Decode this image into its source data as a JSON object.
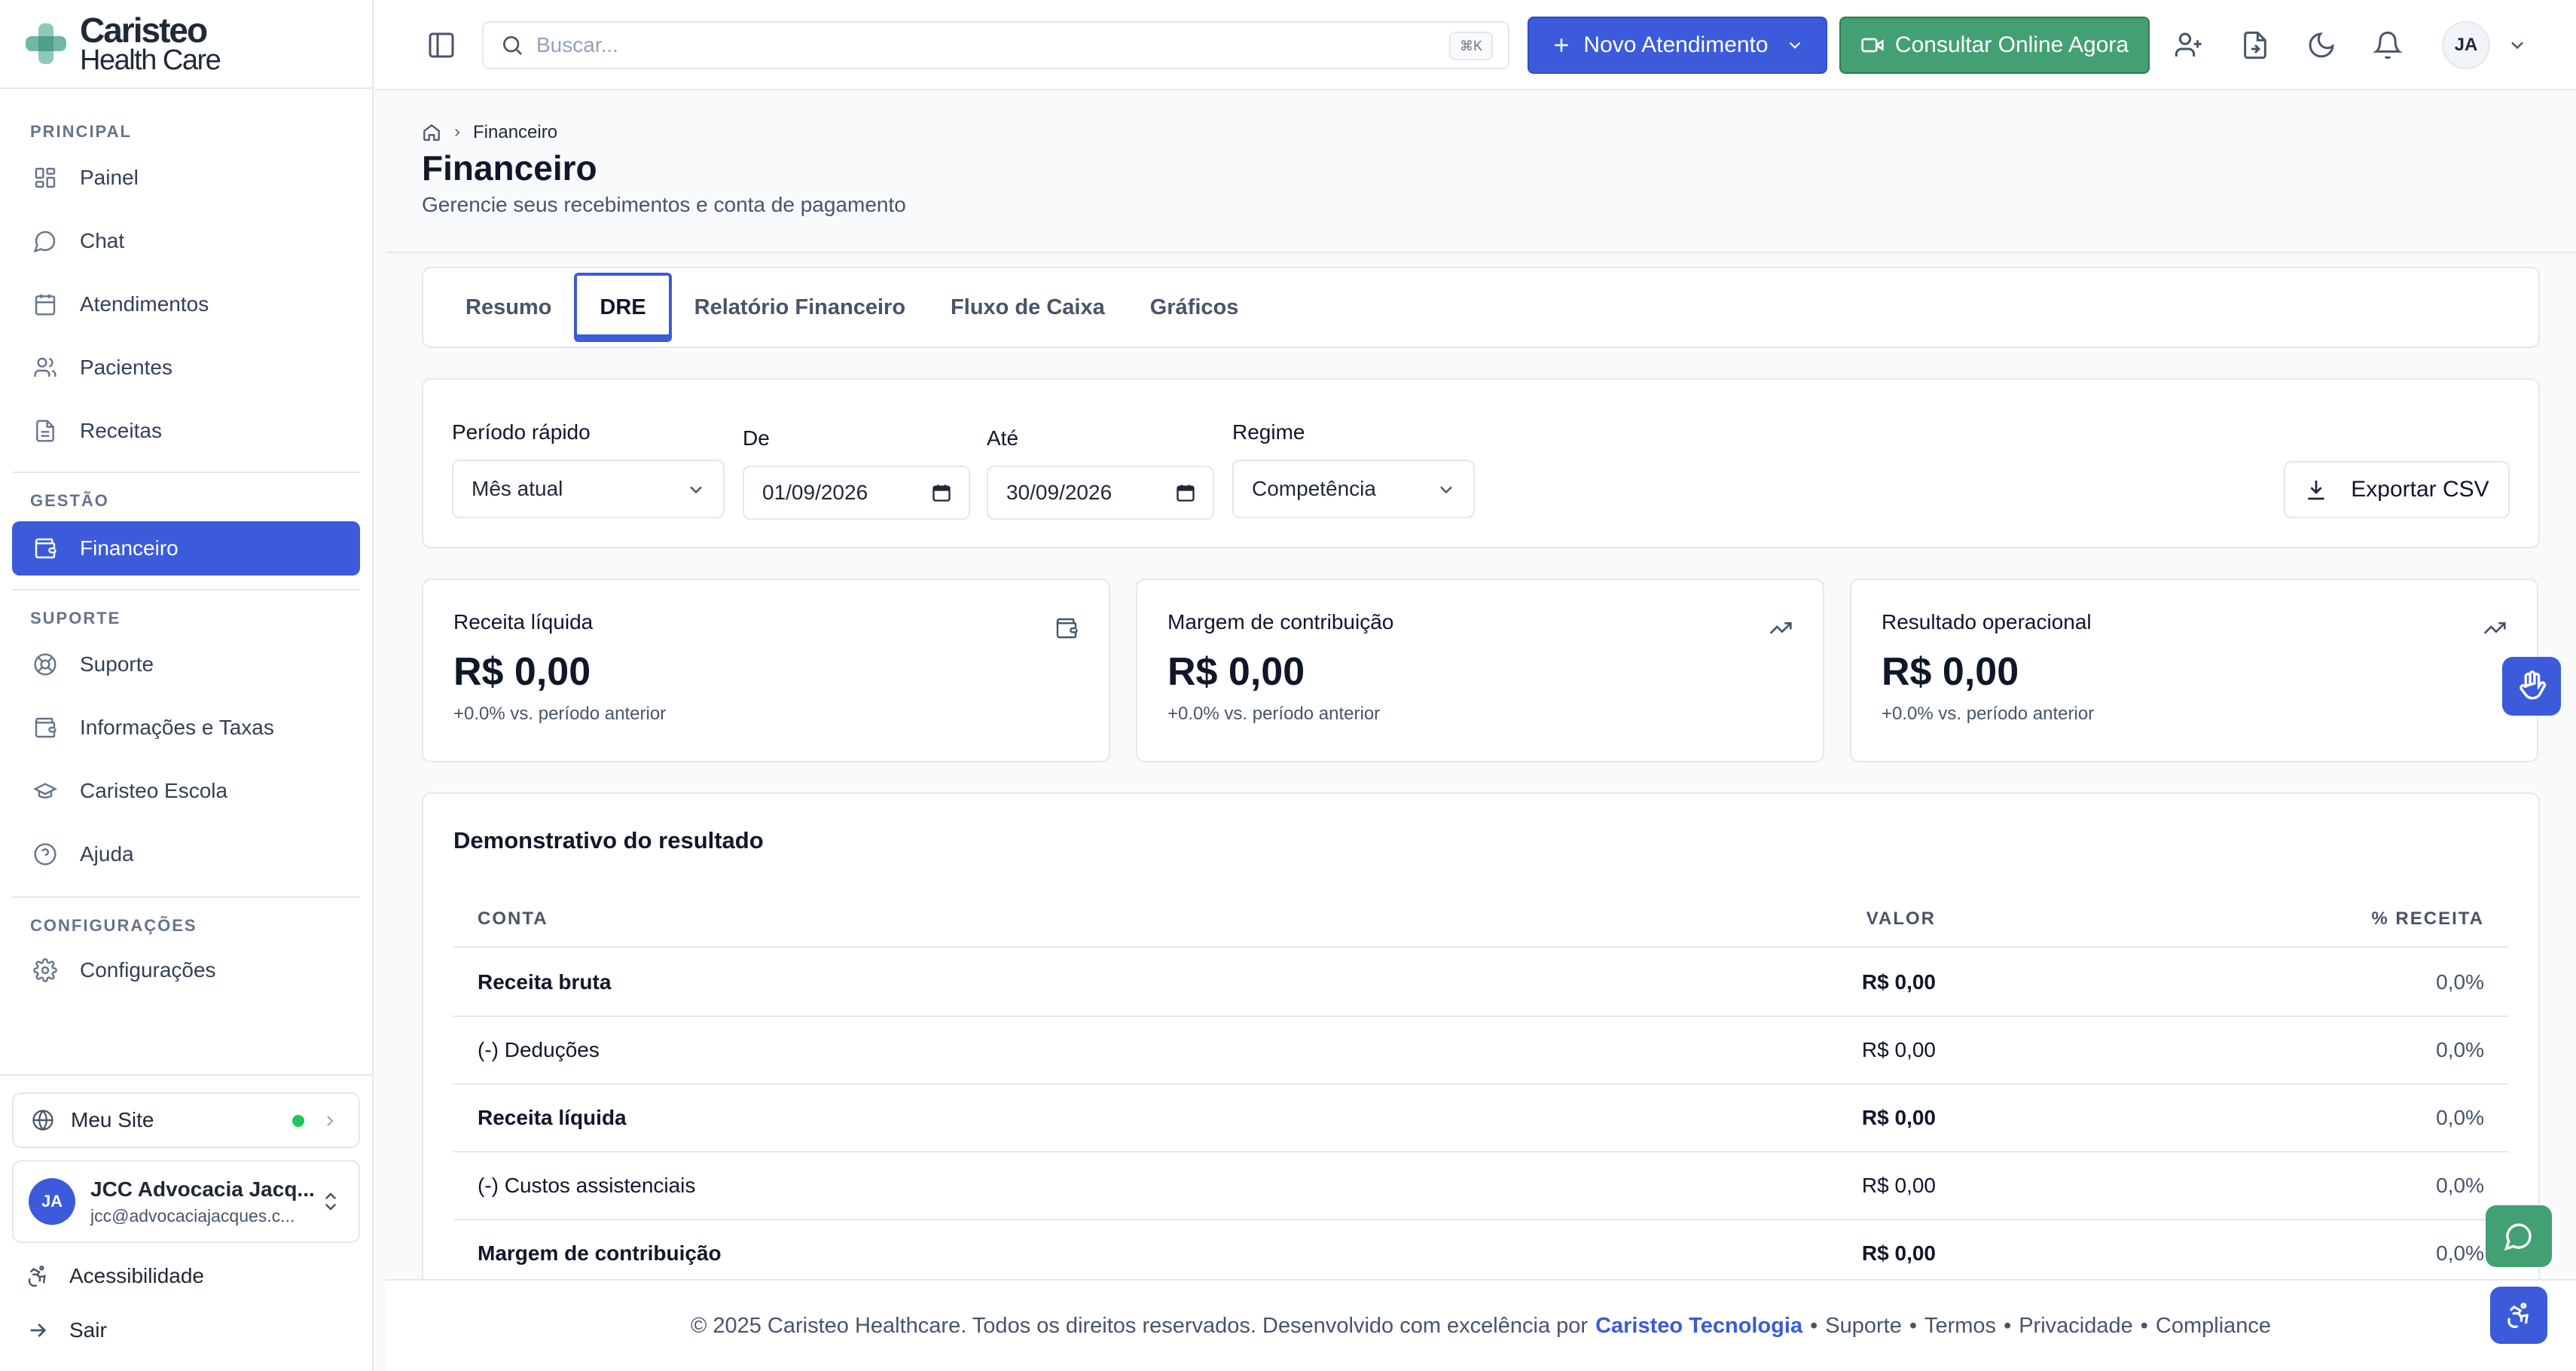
{
  "colors": {
    "primary": "#3b5bdb",
    "green": "#43a073",
    "status_online": "#22c55e",
    "brand_teal": "#6fb8a8"
  },
  "brand": {
    "line1": "Caristeo",
    "line2": "Health Care"
  },
  "sidebar": {
    "sections": {
      "principal": "PRINCIPAL",
      "gestao": "GESTÃO",
      "suporte": "SUPORTE",
      "config": "CONFIGURAÇÕES"
    },
    "items": {
      "painel": "Painel",
      "chat": "Chat",
      "atendimentos": "Atendimentos",
      "pacientes": "Pacientes",
      "receitas": "Receitas",
      "financeiro": "Financeiro",
      "suporte": "Suporte",
      "info": "Informações e Taxas",
      "escola": "Caristeo Escola",
      "ajuda": "Ajuda",
      "config": "Configurações"
    },
    "meu_site": "Meu Site",
    "user": {
      "initials": "JA",
      "name": "JCC Advocacia Jacq...",
      "email": "jcc@advocaciajacques.c..."
    },
    "acessibilidade": "Acessibilidade",
    "sair": "Sair"
  },
  "topbar": {
    "search_placeholder": "Buscar...",
    "shortcut": "⌘K",
    "novo_atendimento": "Novo Atendimento",
    "consultar_online": "Consultar Online Agora",
    "user_initials": "JA"
  },
  "page": {
    "breadcrumb": "Financeiro",
    "title": "Financeiro",
    "subtitle": "Gerencie seus recebimentos e conta de pagamento"
  },
  "tabs": [
    "Resumo",
    "DRE",
    "Relatório Financeiro",
    "Fluxo de Caixa",
    "Gráficos"
  ],
  "filters": {
    "periodo_label": "Período rápido",
    "periodo_value": "Mês atual",
    "de_label": "De",
    "de_value": "01/09/2026",
    "ate_label": "Até",
    "ate_value": "30/09/2026",
    "regime_label": "Regime",
    "regime_value": "Competência",
    "export": "Exportar CSV"
  },
  "kpis": [
    {
      "title": "Receita líquida",
      "value": "R$ 0,00",
      "sub": "+0.0% vs. período anterior",
      "icon": "wallet-icon"
    },
    {
      "title": "Margem de contribuição",
      "value": "R$ 0,00",
      "sub": "+0.0% vs. período anterior",
      "icon": "trending-up-icon"
    },
    {
      "title": "Resultado operacional",
      "value": "R$ 0,00",
      "sub": "+0.0% vs. período anterior",
      "icon": "trending-up-icon"
    }
  ],
  "dre": {
    "title": "Demonstrativo do resultado",
    "columns": [
      "CONTA",
      "VALOR",
      "% RECEITA"
    ],
    "rows": [
      {
        "conta": "Receita bruta",
        "valor": "R$ 0,00",
        "pct": "0,0%"
      },
      {
        "conta": "(-) Deduções",
        "valor": "R$ 0,00",
        "pct": "0,0%"
      },
      {
        "conta": "Receita líquida",
        "valor": "R$ 0,00",
        "pct": "0,0%"
      },
      {
        "conta": "(-) Custos assistenciais",
        "valor": "R$ 0,00",
        "pct": "0,0%"
      },
      {
        "conta": "Margem de contribuição",
        "valor": "R$ 0,00",
        "pct": "0,0%"
      }
    ]
  },
  "footer": {
    "text": "© 2025 Caristeo Healthcare. Todos os direitos reservados. Desenvolvido com excelência por",
    "company": "Caristeo Tecnologia",
    "sep": "•",
    "links": [
      "Suporte",
      "Termos",
      "Privacidade",
      "Compliance"
    ]
  }
}
